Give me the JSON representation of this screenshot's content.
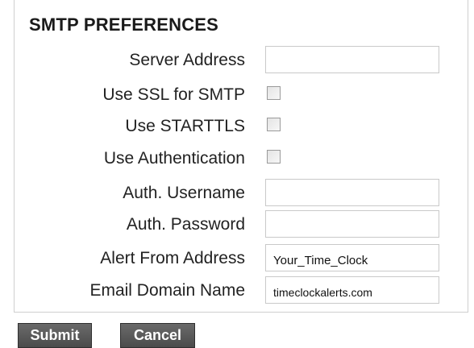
{
  "section_title": "SMTP PREFERENCES",
  "fields": [
    {
      "label": "Server Address",
      "type": "text",
      "value": "",
      "placeholder": ""
    },
    {
      "label": "Use SSL for SMTP",
      "type": "checkbox",
      "checked": false
    },
    {
      "label": "Use STARTTLS",
      "type": "checkbox",
      "checked": false
    },
    {
      "label": "Use Authentication",
      "type": "checkbox",
      "checked": false
    },
    {
      "label": "Auth. Username",
      "type": "text",
      "value": "",
      "placeholder": ""
    },
    {
      "label": "Auth. Password",
      "type": "password",
      "value": "",
      "placeholder": ""
    },
    {
      "label": "Alert From Address",
      "type": "text",
      "value": "Your_Time_Clock",
      "placeholder": ""
    },
    {
      "label": "Email Domain Name",
      "type": "text",
      "value": "timeclockalerts.com",
      "placeholder": ""
    }
  ],
  "buttons": {
    "submit_label": "Submit",
    "cancel_label": "Cancel"
  },
  "colors": {
    "button_background": "#555555",
    "button_text": "#ffffff",
    "border": "#c9c9c9"
  }
}
